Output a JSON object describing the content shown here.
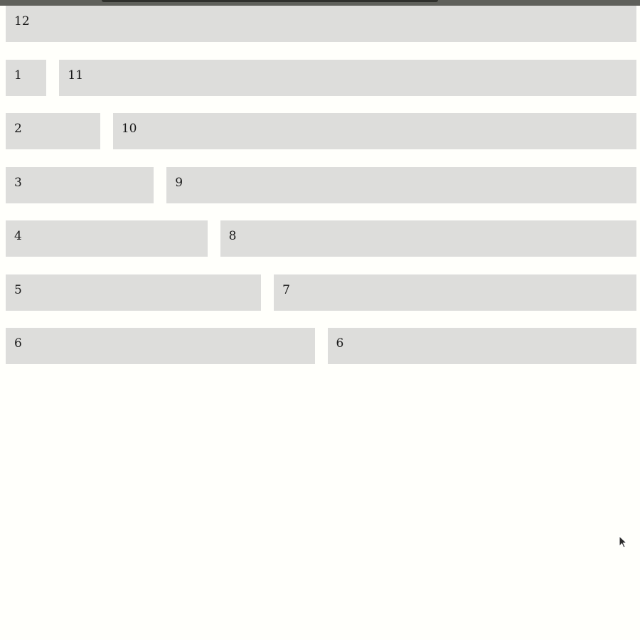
{
  "rows": [
    {
      "cells": [
        {
          "label": "12",
          "span": 12
        }
      ]
    },
    {
      "cells": [
        {
          "label": "1",
          "span": 1
        },
        {
          "label": "11",
          "span": 11
        }
      ]
    },
    {
      "cells": [
        {
          "label": "2",
          "span": 2
        },
        {
          "label": "10",
          "span": 10
        }
      ]
    },
    {
      "cells": [
        {
          "label": "3",
          "span": 3
        },
        {
          "label": "9",
          "span": 9
        }
      ]
    },
    {
      "cells": [
        {
          "label": "4",
          "span": 4
        },
        {
          "label": "8",
          "span": 8
        }
      ]
    },
    {
      "cells": [
        {
          "label": "5",
          "span": 5
        },
        {
          "label": "7",
          "span": 7
        }
      ]
    },
    {
      "cells": [
        {
          "label": "6",
          "span": 6
        },
        {
          "label": "6",
          "span": 6
        }
      ]
    }
  ]
}
